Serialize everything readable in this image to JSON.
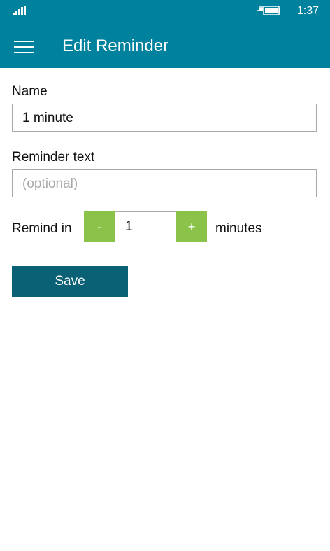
{
  "status_bar": {
    "time": "1:37",
    "signal_icon": "signal-strength-icon",
    "battery_icon": "battery-charging-icon"
  },
  "app_bar": {
    "menu_icon": "hamburger-menu-icon",
    "title": "Edit Reminder"
  },
  "form": {
    "name_label": "Name",
    "name_value": "1 minute",
    "reminder_text_label": "Reminder text",
    "reminder_text_value": "",
    "reminder_text_placeholder": "(optional)",
    "remind_in_label": "Remind in",
    "decrement_label": "-",
    "increment_label": "+",
    "remind_in_value": "1",
    "unit_label": "minutes",
    "save_label": "Save"
  },
  "colors": {
    "accent": "#00819d",
    "save_button": "#0a6176",
    "stepper_button": "#8bc34a"
  }
}
